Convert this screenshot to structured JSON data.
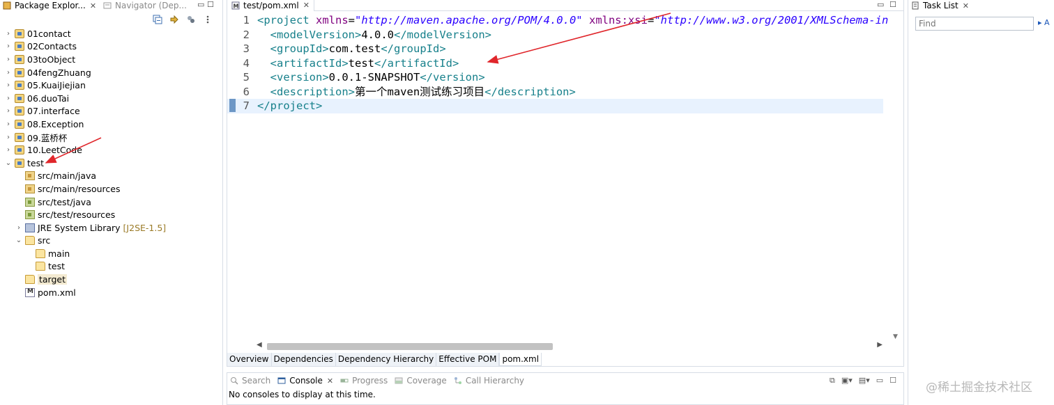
{
  "left_pane": {
    "tabs": [
      {
        "label": "Package Explor...",
        "icon": "package-explorer-icon",
        "active": true
      },
      {
        "label": "Navigator (Dep...",
        "icon": "navigator-icon",
        "active": false
      }
    ],
    "tree": [
      {
        "label": "01contact",
        "icon": "project-icon",
        "level": 0,
        "expander": "collapsed"
      },
      {
        "label": "02Contacts",
        "icon": "project-icon",
        "level": 0,
        "expander": "collapsed"
      },
      {
        "label": "03toObject",
        "icon": "project-icon",
        "level": 0,
        "expander": "collapsed"
      },
      {
        "label": "04fengZhuang",
        "icon": "project-icon",
        "level": 0,
        "expander": "collapsed"
      },
      {
        "label": "05.KuaiJiejian",
        "icon": "project-icon",
        "level": 0,
        "expander": "collapsed"
      },
      {
        "label": "06.duoTai",
        "icon": "project-icon",
        "level": 0,
        "expander": "collapsed"
      },
      {
        "label": "07.interface",
        "icon": "project-icon",
        "level": 0,
        "expander": "collapsed"
      },
      {
        "label": "08.Exception",
        "icon": "project-icon",
        "level": 0,
        "expander": "collapsed"
      },
      {
        "label": "09.蓝桥杯",
        "icon": "project-icon",
        "level": 0,
        "expander": "collapsed"
      },
      {
        "label": "10.LeetCode",
        "icon": "project-icon",
        "level": 0,
        "expander": "collapsed"
      },
      {
        "label": "test",
        "icon": "maven-project-icon",
        "level": 0,
        "expander": "expanded"
      },
      {
        "label": "src/main/java",
        "icon": "source-folder-icon",
        "level": 1,
        "expander": "none"
      },
      {
        "label": "src/main/resources",
        "icon": "source-folder-icon",
        "level": 1,
        "expander": "none"
      },
      {
        "label": "src/test/java",
        "icon": "test-source-folder-icon",
        "level": 1,
        "expander": "none"
      },
      {
        "label": "src/test/resources",
        "icon": "test-source-folder-icon",
        "level": 1,
        "expander": "none"
      },
      {
        "label": "JRE System Library",
        "decoration": "[J2SE-1.5]",
        "icon": "library-icon",
        "level": 1,
        "expander": "collapsed"
      },
      {
        "label": "src",
        "icon": "folder-icon",
        "level": 1,
        "expander": "expanded"
      },
      {
        "label": "main",
        "icon": "folder-icon",
        "level": 2,
        "expander": "none"
      },
      {
        "label": "test",
        "icon": "folder-icon",
        "level": 2,
        "expander": "none"
      },
      {
        "label": "target",
        "icon": "folder-icon",
        "level": 1,
        "expander": "none",
        "selected": true
      },
      {
        "label": "pom.xml",
        "icon": "xml-file-icon",
        "level": 1,
        "expander": "none"
      }
    ]
  },
  "editor": {
    "tab_label": "test/pom.xml",
    "lines": [
      {
        "no": "1",
        "segments": [
          [
            "tag",
            "<project "
          ],
          [
            "attr",
            "xmlns"
          ],
          [
            "txt",
            "="
          ],
          [
            "str",
            "\"http://maven.apache.org/POM/4.0.0\""
          ],
          [
            "txt",
            " "
          ],
          [
            "attr",
            "xmlns:xsi"
          ],
          [
            "txt",
            "="
          ],
          [
            "str",
            "\"http://www.w3.org/2001/XMLSchema-in"
          ]
        ]
      },
      {
        "no": "2",
        "segments": [
          [
            "txt",
            "  "
          ],
          [
            "tag",
            "<modelVersion>"
          ],
          [
            "txt",
            "4.0.0"
          ],
          [
            "tag",
            "</modelVersion>"
          ]
        ]
      },
      {
        "no": "3",
        "segments": [
          [
            "txt",
            "  "
          ],
          [
            "tag",
            "<groupId>"
          ],
          [
            "txt",
            "com.test"
          ],
          [
            "tag",
            "</groupId>"
          ]
        ]
      },
      {
        "no": "4",
        "segments": [
          [
            "txt",
            "  "
          ],
          [
            "tag",
            "<artifactId>"
          ],
          [
            "txt",
            "test"
          ],
          [
            "tag",
            "</artifactId>"
          ]
        ]
      },
      {
        "no": "5",
        "segments": [
          [
            "txt",
            "  "
          ],
          [
            "tag",
            "<version>"
          ],
          [
            "txt",
            "0.0.1-SNAPSHOT"
          ],
          [
            "tag",
            "</version>"
          ]
        ]
      },
      {
        "no": "6",
        "segments": [
          [
            "txt",
            "  "
          ],
          [
            "tag",
            "<description>"
          ],
          [
            "txt",
            "第一个maven测试练习项目"
          ],
          [
            "tag",
            "</description>"
          ]
        ]
      },
      {
        "no": "7",
        "segments": [
          [
            "tag",
            "</project>"
          ]
        ],
        "current": true
      }
    ],
    "page_tabs": [
      "Overview",
      "Dependencies",
      "Dependency Hierarchy",
      "Effective POM",
      "pom.xml"
    ],
    "active_page_tab": "pom.xml"
  },
  "console": {
    "tabs": [
      {
        "label": "Search",
        "icon": "search-icon"
      },
      {
        "label": "Console",
        "icon": "console-icon",
        "active": true
      },
      {
        "label": "Progress",
        "icon": "progress-icon"
      },
      {
        "label": "Coverage",
        "icon": "coverage-icon"
      },
      {
        "label": "Call Hierarchy",
        "icon": "call-hierarchy-icon"
      }
    ],
    "message": "No consoles to display at this time."
  },
  "right_pane": {
    "tab_label": "Task List",
    "find_placeholder": "Find",
    "find_arrow": "A"
  },
  "watermark": "@稀土掘金技术社区",
  "colors": {
    "xml_tag": "#17808b",
    "xml_attr": "#7f007f",
    "xml_string": "#2a00ff",
    "annotation_arrow": "#e0262b",
    "current_line": "#e8f2fe"
  }
}
